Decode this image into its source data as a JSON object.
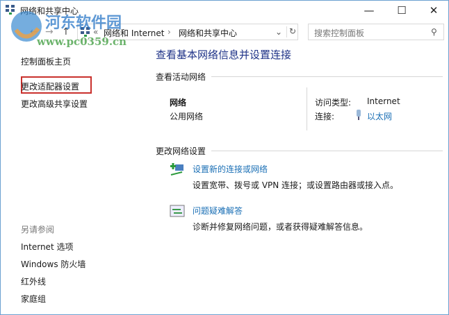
{
  "window": {
    "title": "网络和共享中心",
    "minimize": "—",
    "maximize": "☐",
    "close": "✕"
  },
  "address": {
    "chevron": "«",
    "crumbs": [
      "网络和 Internet",
      "网络和共享中心"
    ],
    "sep": "›",
    "dropdown": "⌄",
    "refresh": "↻"
  },
  "search": {
    "placeholder": "搜索控制面板",
    "icon": "⚲"
  },
  "nav": {
    "back": "←",
    "forward": "→",
    "up": "↑"
  },
  "sidebar": {
    "home": "控制面板主页",
    "items": [
      "更改适配器设置",
      "更改高级共享设置"
    ],
    "see_also": "另请参阅",
    "see_also_items": [
      "Internet 选项",
      "Windows 防火墙",
      "红外线",
      "家庭组"
    ]
  },
  "main": {
    "title": "查看基本网络信息并设置连接",
    "active_section": "查看活动网络",
    "network_name": "网络",
    "network_type": "公用网络",
    "access_label": "访问类型:",
    "access_value": "Internet",
    "conn_label": "连接:",
    "conn_value": "以太网",
    "change_section": "更改网络设置",
    "tasks": [
      {
        "title": "设置新的连接或网络",
        "desc": "设置宽带、拨号或 VPN 连接；或设置路由器或接入点。"
      },
      {
        "title": "问题疑难解答",
        "desc": "诊断并修复网络问题，或者获得疑难解答信息。"
      }
    ]
  },
  "watermark": {
    "name": "河东软件园",
    "url": "www.pc0359.cn"
  }
}
